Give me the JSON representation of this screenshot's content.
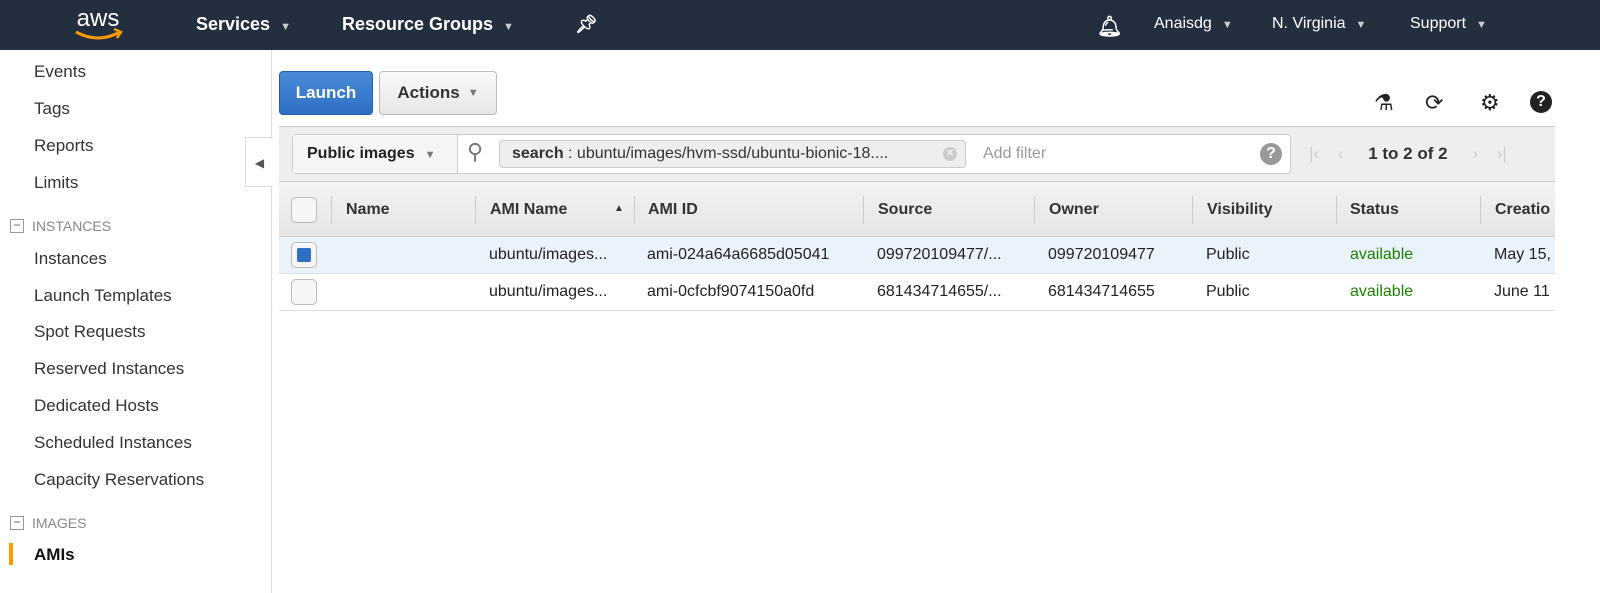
{
  "topbar": {
    "logo": "aws",
    "services": "Services",
    "resource_groups": "Resource Groups",
    "user": "Anaisdg",
    "region": "N. Virginia",
    "support": "Support"
  },
  "sidebar": {
    "items_top": [
      "Events",
      "Tags",
      "Reports",
      "Limits"
    ],
    "instances_header": "INSTANCES",
    "instances": [
      "Instances",
      "Launch Templates",
      "Spot Requests",
      "Reserved Instances",
      "Dedicated Hosts",
      "Scheduled Instances",
      "Capacity Reservations"
    ],
    "images_header": "IMAGES",
    "active": "AMIs"
  },
  "toolbar": {
    "launch": "Launch",
    "actions": "Actions"
  },
  "filter": {
    "scope": "Public images",
    "chip_key": "search",
    "chip_value": " : ubuntu/images/hvm-ssd/ubuntu-bionic-18....",
    "placeholder": "Add filter",
    "pagination": "1 to 2 of 2"
  },
  "table": {
    "columns": [
      "Name",
      "AMI Name",
      "AMI ID",
      "Source",
      "Owner",
      "Visibility",
      "Status",
      "Creatio"
    ],
    "rows": [
      {
        "selected": true,
        "name": "",
        "ami_name": "ubuntu/images...",
        "ami_id": "ami-024a64a6685d05041",
        "source": "099720109477/...",
        "owner": "099720109477",
        "visibility": "Public",
        "status": "available",
        "creation": "May 15,"
      },
      {
        "selected": false,
        "name": "",
        "ami_name": "ubuntu/images...",
        "ami_id": "ami-0cfcbf9074150a0fd",
        "source": "681434714655/...",
        "owner": "681434714655",
        "visibility": "Public",
        "status": "available",
        "creation": "June 11"
      }
    ]
  },
  "colors": {
    "topbar": "#232f3e",
    "accent": "#ff9900",
    "primary": "#2d6fc4",
    "available": "#1d8102"
  }
}
